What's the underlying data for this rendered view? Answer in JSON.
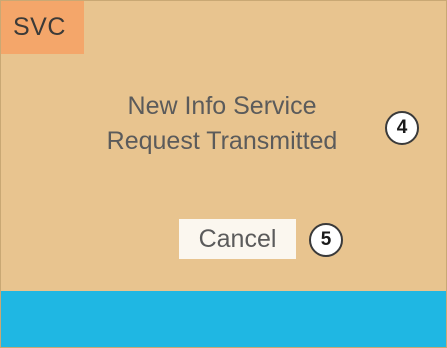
{
  "header": {
    "tag_label": "SVC"
  },
  "message": {
    "line1": "New Info Service",
    "line2": "Request Transmitted"
  },
  "actions": {
    "cancel_label": "Cancel"
  },
  "callouts": {
    "message_number": "4",
    "cancel_number": "5"
  },
  "colors": {
    "background": "#e8c48f",
    "tag": "#f4a66a",
    "bottom_bar": "#1fb7e3",
    "button": "#fbf7ef"
  }
}
